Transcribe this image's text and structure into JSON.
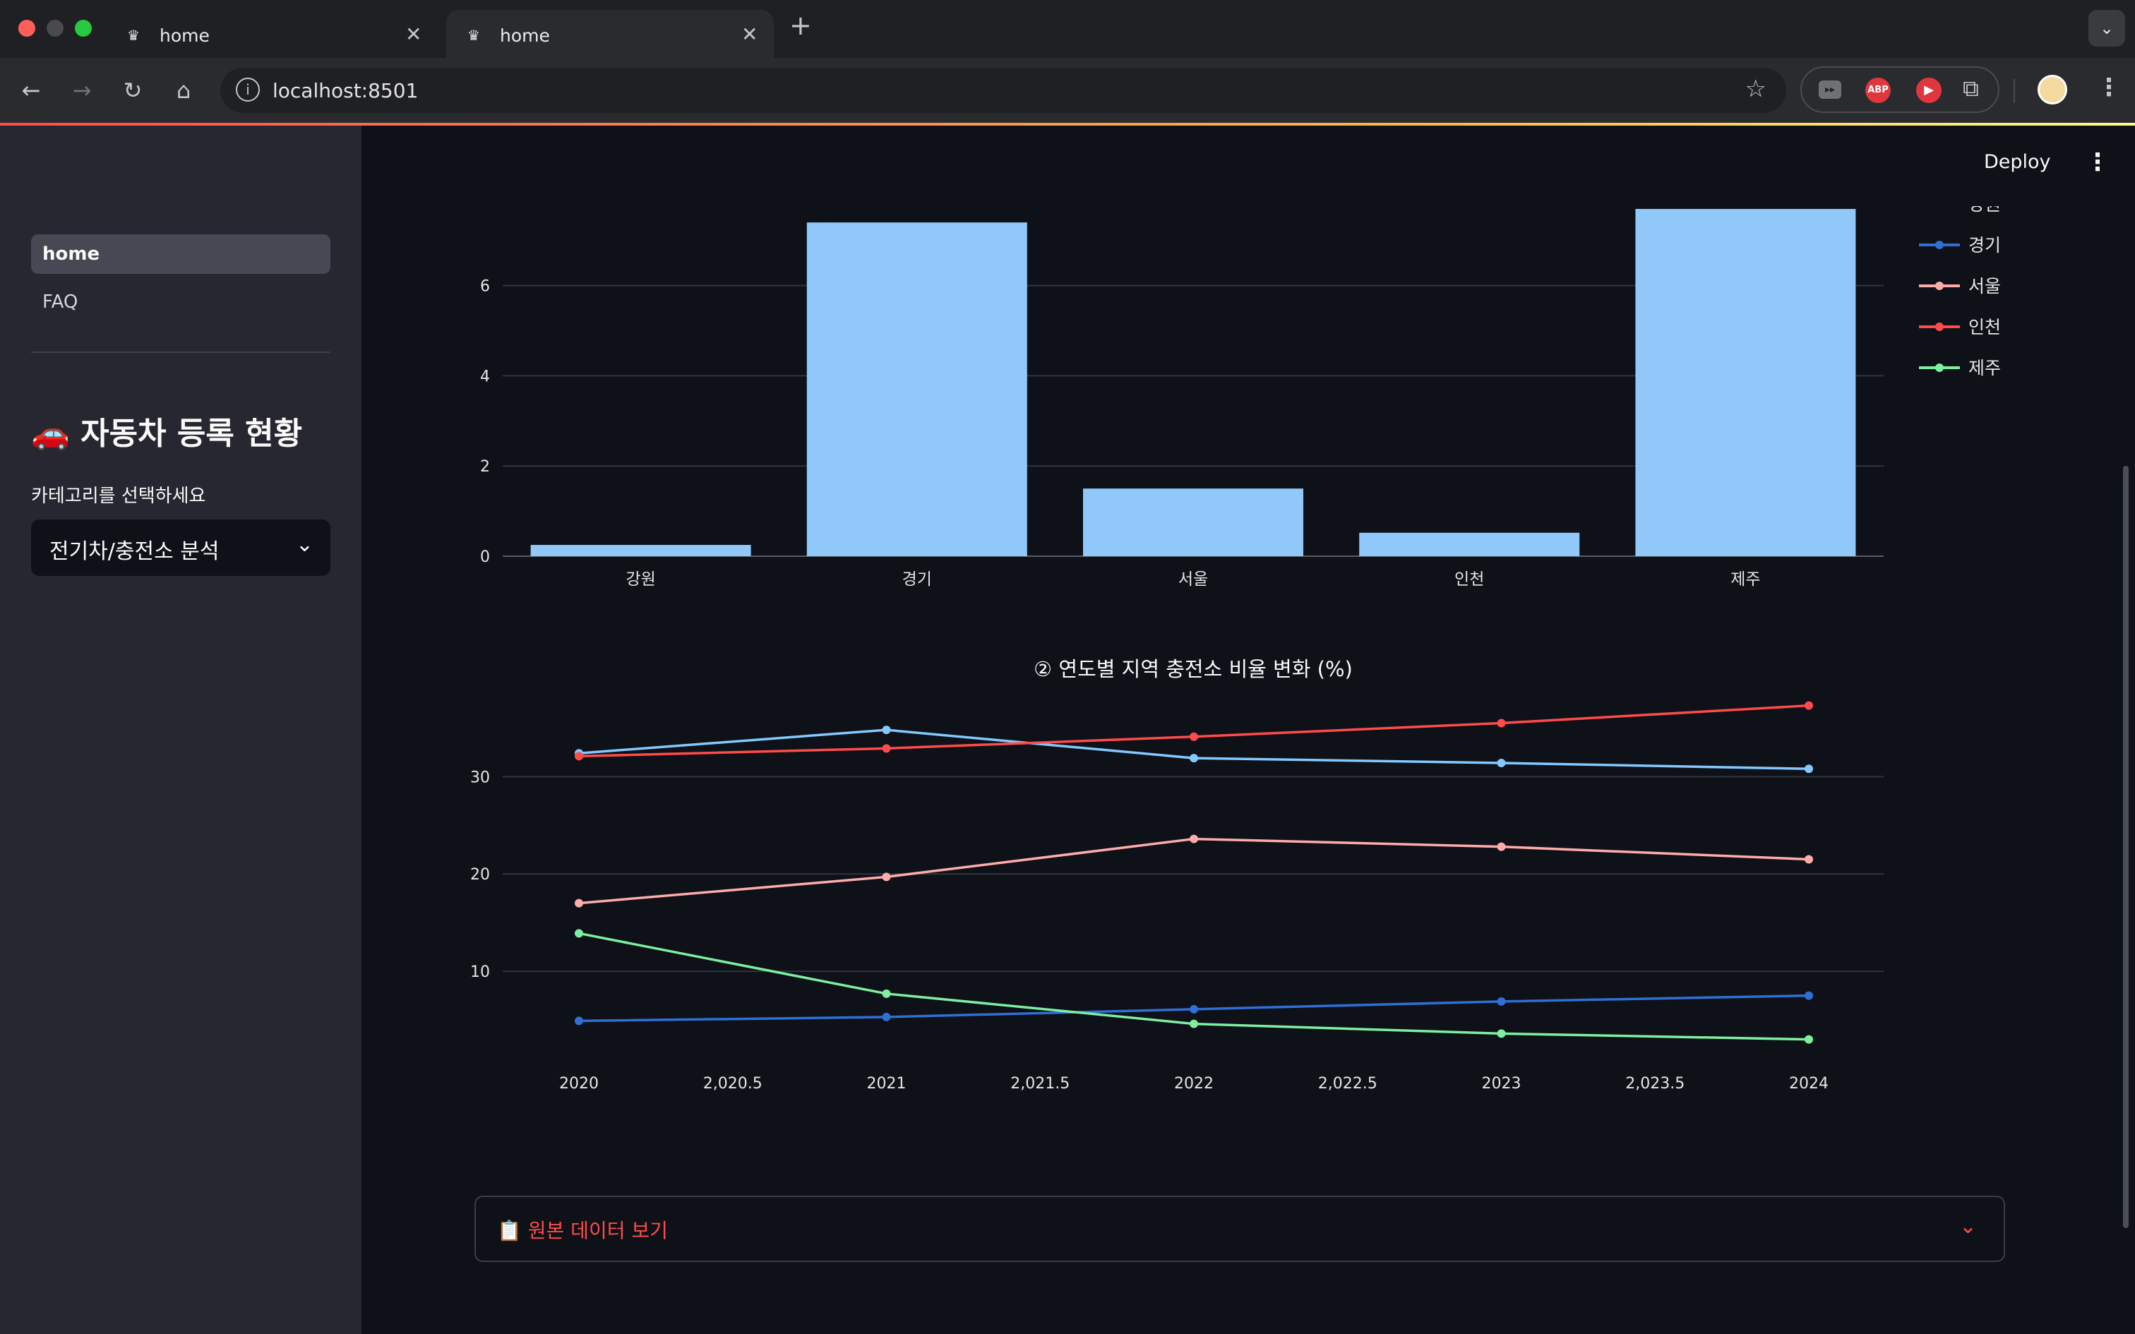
{
  "browser": {
    "tabs": [
      {
        "title": "home"
      },
      {
        "title": "home"
      }
    ],
    "url": "localhost:8501",
    "ext_abp": "ABP"
  },
  "header": {
    "deploy": "Deploy"
  },
  "sidebar": {
    "nav": [
      {
        "label": "home",
        "active": true
      },
      {
        "label": "FAQ",
        "active": false
      }
    ],
    "title": "🚗 자동차 등록 현황",
    "select_label": "카테고리를 선택하세요",
    "select_value": "전기차/충전소 분석"
  },
  "chart_data": [
    {
      "type": "bar",
      "categories": [
        "강원",
        "경기",
        "서울",
        "인천",
        "제주"
      ],
      "values": [
        0.25,
        7.4,
        1.5,
        0.52,
        7.7
      ],
      "ylim": [
        0,
        7.7
      ],
      "yticks": [
        0,
        2,
        4,
        6
      ],
      "color": "#90c8fa",
      "grid": true
    },
    {
      "type": "line",
      "title": "② 연도별 지역 충전소 비율 변화 (%)",
      "x": [
        2020,
        2021,
        2022,
        2023,
        2024
      ],
      "xticks": [
        2020,
        2020.5,
        2021,
        2021.5,
        2022,
        2022.5,
        2023,
        2023.5,
        2024
      ],
      "xtick_labels": [
        "2020",
        "2,020.5",
        "2021",
        "2,021.5",
        "2022",
        "2,022.5",
        "2023",
        "2,023.5",
        "2024"
      ],
      "yticks": [
        10,
        20,
        30
      ],
      "ylim": [
        0,
        38
      ],
      "legend_position": "right",
      "series": [
        {
          "name": "강원",
          "color": "#83c9ff",
          "values": [
            32.4,
            34.8,
            31.9,
            31.4,
            30.8
          ]
        },
        {
          "name": "경기",
          "color": "#2f6fd6",
          "values": [
            4.9,
            5.3,
            6.1,
            6.9,
            7.5
          ]
        },
        {
          "name": "서울",
          "color": "#ffabab",
          "values": [
            17.0,
            19.7,
            23.6,
            22.8,
            21.5
          ]
        },
        {
          "name": "인천",
          "color": "#ff4b4b",
          "values": [
            32.1,
            32.9,
            34.1,
            35.5,
            37.3
          ]
        },
        {
          "name": "제주",
          "color": "#7defa1",
          "values": [
            13.9,
            7.7,
            4.6,
            3.6,
            3.0
          ]
        }
      ],
      "legend_clipped_label": "강원"
    }
  ],
  "expander": {
    "label": "📋 원본 데이터 보기"
  }
}
